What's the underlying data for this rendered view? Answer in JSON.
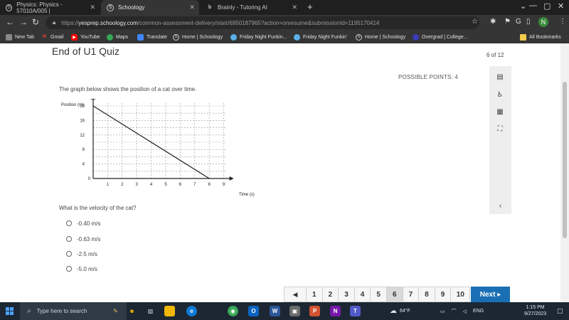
{
  "browser": {
    "tabs": [
      {
        "label": "Physics: Physics - 57010A/005 |",
        "icon": "schoology-icon"
      },
      {
        "label": "Schoology",
        "icon": "schoology-icon"
      },
      {
        "label": "Brainly - Tutoring AI",
        "icon": "brainly-icon"
      }
    ],
    "url": {
      "scheme": "https://",
      "host": "yesprep.schoology.com",
      "path": "/common-assessment-delivery/start/6950187965?action=onresume&submissionId=1195170414"
    },
    "bookmarks": [
      "New Tab",
      "Gmail",
      "YouTube",
      "Maps",
      "Translate",
      "Home | Schoology",
      "Friday Night Funkin...",
      "Friday Night Funkin'",
      "Home | Schoology",
      "Overgrad | College...",
      "All Bookmarks"
    ],
    "avatar_letter": "N"
  },
  "quiz": {
    "title": "End of U1 Quiz",
    "count": "6 of 12",
    "points": "POSSIBLE POINTS: 4",
    "prompt": "The graph below shows the position of a cat over time.",
    "question": "What is the velocity of the cat?",
    "options": [
      "-0.40 m/s",
      "-0.63 m/s",
      "-2.5 m/s",
      "-5.0 m/s"
    ]
  },
  "chart_data": {
    "type": "line",
    "ylabel": "Position (m)",
    "xlabel": "Time (s)",
    "xlim": [
      0,
      9
    ],
    "ylim": [
      0,
      20
    ],
    "xticks": [
      1,
      2,
      3,
      4,
      5,
      6,
      7,
      8,
      9
    ],
    "yticks": [
      4,
      8,
      12,
      16,
      20
    ],
    "origin_label": "0",
    "grid": true,
    "series": [
      {
        "x": [
          0,
          8
        ],
        "y": [
          20,
          0
        ]
      }
    ]
  },
  "pager": {
    "prev": "◀",
    "pages": [
      "1",
      "2",
      "3",
      "4",
      "5",
      "6",
      "7",
      "8",
      "9",
      "10"
    ],
    "current": "6",
    "next": "Next ▸"
  },
  "taskbar": {
    "search_placeholder": "Type here to search",
    "weather": "64°F",
    "lang": "ENG",
    "time": "1:15 PM",
    "date": "9/27/2023"
  }
}
